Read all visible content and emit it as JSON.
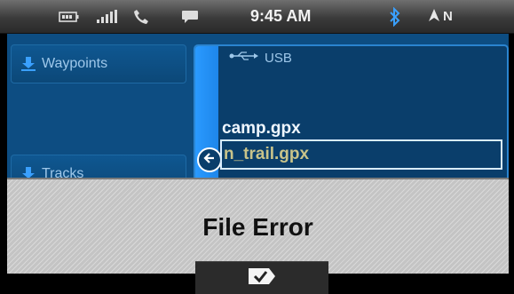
{
  "status_bar": {
    "time": "9:45 AM",
    "heading": "N",
    "icons": [
      "battery-icon",
      "signal-icon",
      "phone-icon",
      "message-icon",
      "bluetooth-icon",
      "compass-arrow-icon"
    ]
  },
  "browser": {
    "categories": [
      {
        "label": "Waypoints",
        "icon": "download-arrow-icon"
      },
      {
        "label": "Tracks",
        "icon": "download-arrow-icon"
      }
    ],
    "source_label": "USB",
    "files": [
      {
        "name": "camp.gpx",
        "selected": false
      },
      {
        "name": "n_trail.gpx",
        "selected": true
      }
    ]
  },
  "dialog": {
    "title": "File Error",
    "confirm_icon": "checkmark-icon"
  },
  "colors": {
    "panel_blue": "#0d4d82",
    "scroll_rail": "#2a9aff",
    "selected_text": "#c9c48a"
  }
}
